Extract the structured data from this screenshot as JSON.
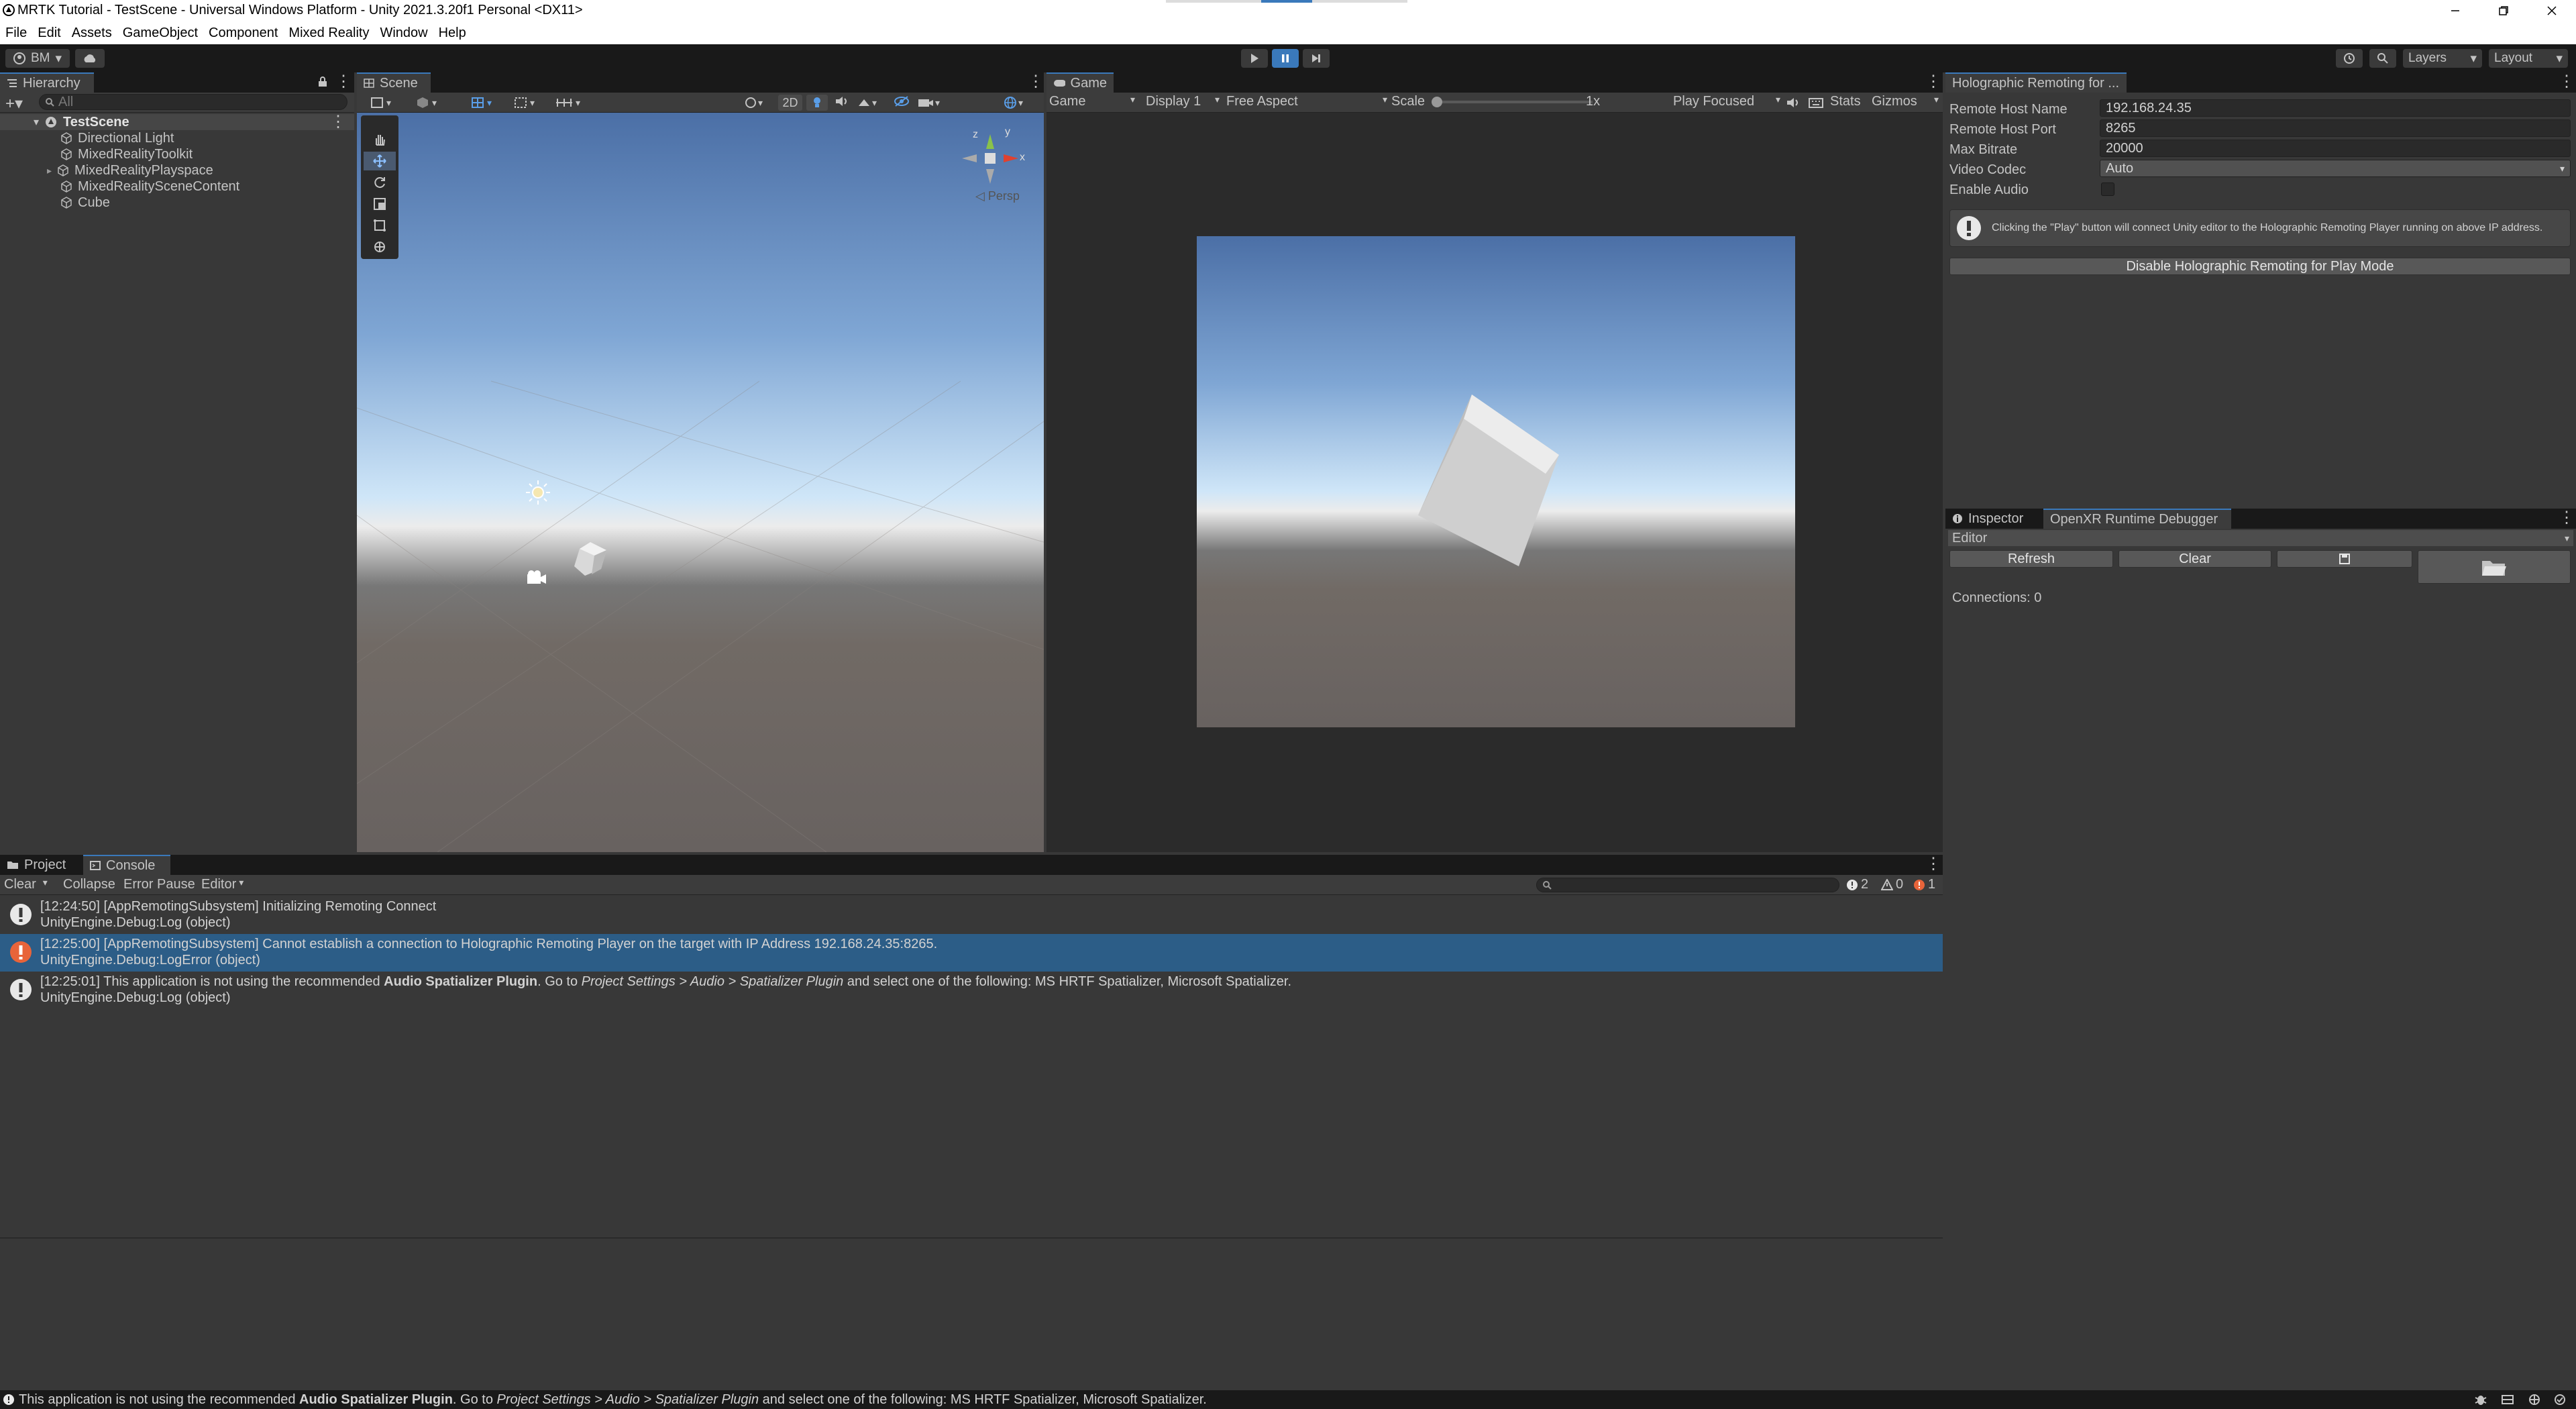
{
  "window": {
    "title": "MRTK Tutorial - TestScene - Universal Windows Platform - Unity 2021.3.20f1 Personal <DX11>"
  },
  "menu": [
    "File",
    "Edit",
    "Assets",
    "GameObject",
    "Component",
    "Mixed Reality",
    "Window",
    "Help"
  ],
  "toolbar": {
    "account": "BM",
    "layers": "Layers",
    "layout": "Layout"
  },
  "hierarchy": {
    "tab": "Hierarchy",
    "search_placeholder": "All",
    "scene": "TestScene",
    "items": [
      "Directional Light",
      "MixedRealityToolkit",
      "MixedRealityPlayspace",
      "MixedRealitySceneContent",
      "Cube"
    ]
  },
  "scene": {
    "tab": "Scene",
    "mode_2d": "2D",
    "persp": "◁ Persp",
    "gizmo_y": "y",
    "gizmo_x": "x",
    "gizmo_z": "z"
  },
  "game": {
    "tab": "Game",
    "view_mode": "Game",
    "display": "Display 1",
    "aspect": "Free Aspect",
    "scale_label": "Scale",
    "scale_value": "1x",
    "play_mode": "Play Focused",
    "stats": "Stats",
    "gizmos": "Gizmos"
  },
  "remoting": {
    "tab": "Holographic Remoting for ...",
    "fields": [
      {
        "label": "Remote Host Name",
        "value": "192.168.24.35"
      },
      {
        "label": "Remote Host Port",
        "value": "8265"
      },
      {
        "label": "Max Bitrate",
        "value": "20000"
      },
      {
        "label": "Video Codec",
        "value": "Auto"
      }
    ],
    "enable_audio_label": "Enable Audio",
    "info": "Clicking the \"Play\" button will connect Unity editor to the Holographic Remoting Player running on above IP address.",
    "disable_button": "Disable Holographic Remoting for Play Mode"
  },
  "inspector": {
    "tab": "Inspector",
    "tab2": "OpenXR Runtime Debugger",
    "editor": "Editor",
    "refresh": "Refresh",
    "clear": "Clear",
    "connections": "Connections: 0"
  },
  "console": {
    "tab_project": "Project",
    "tab_console": "Console",
    "clear": "Clear",
    "collapse": "Collapse",
    "error_pause": "Error Pause",
    "editor": "Editor",
    "count_log": "2",
    "count_warn": "0",
    "count_err": "1",
    "logs": [
      {
        "type": "log",
        "l1": "[12:24:50] [AppRemotingSubsystem] Initializing Remoting Connect",
        "l2": "UnityEngine.Debug:Log (object)"
      },
      {
        "type": "error",
        "l1": "[12:25:00] [AppRemotingSubsystem] Cannot establish a connection to Holographic Remoting Player on the target with IP Address 192.168.24.35:8265.",
        "l2": "UnityEngine.Debug:LogError (object)"
      },
      {
        "type": "log",
        "l1_a": "[12:25:01] This application is not using the recommended ",
        "l1_b": "Audio Spatializer Plugin",
        "l1_c": ". Go to ",
        "l1_d": "Project Settings > Audio > Spatializer Plugin",
        "l1_e": " and select one of the following: MS HRTF Spatializer, Microsoft Spatializer.",
        "l2": "UnityEngine.Debug:Log (object)"
      }
    ]
  },
  "status": {
    "a": "This application is not using the recommended ",
    "b": "Audio Spatializer Plugin",
    "c": ". Go to ",
    "d": "Project Settings > Audio > Spatializer Plugin",
    "e": " and select one of the following: MS HRTF Spatializer, Microsoft Spatializer."
  },
  "colors": {
    "accent": "#3a79bb",
    "error": "#e8643a",
    "selected_row": "#2c5d87"
  }
}
